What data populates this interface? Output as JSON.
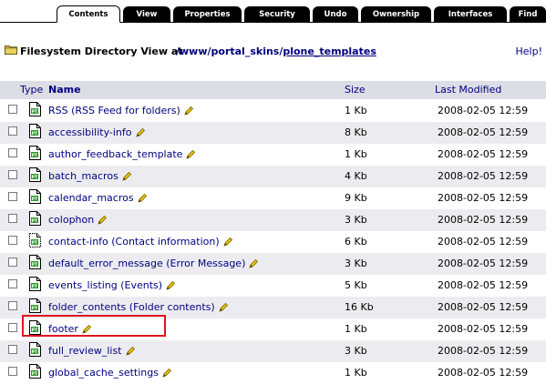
{
  "tabs": [
    {
      "label": "Contents",
      "active": true
    },
    {
      "label": "View",
      "active": false
    },
    {
      "label": "Properties",
      "active": false
    },
    {
      "label": "Security",
      "active": false
    },
    {
      "label": "Undo",
      "active": false
    },
    {
      "label": "Ownership",
      "active": false
    },
    {
      "label": "Interfaces",
      "active": false
    },
    {
      "label": "Find",
      "active": false
    }
  ],
  "header": {
    "label": "Filesystem Directory View at",
    "path_prefix": "/www/portal_skins/",
    "path_current": "plone_templates",
    "help": "Help!"
  },
  "columns": {
    "type": "Type",
    "name": "Name",
    "size": "Size",
    "modified": "Last Modified"
  },
  "rows": [
    {
      "name": "RSS (RSS Feed for folders)",
      "size": "1 Kb",
      "modified": "2008-02-05 12:59",
      "icon": "page-template-icon"
    },
    {
      "name": "accessibility-info",
      "size": "8 Kb",
      "modified": "2008-02-05 12:59",
      "icon": "page-template-icon"
    },
    {
      "name": "author_feedback_template",
      "size": "1 Kb",
      "modified": "2008-02-05 12:59",
      "icon": "page-template-icon"
    },
    {
      "name": "batch_macros",
      "size": "4 Kb",
      "modified": "2008-02-05 12:59",
      "icon": "page-template-icon"
    },
    {
      "name": "calendar_macros",
      "size": "9 Kb",
      "modified": "2008-02-05 12:59",
      "icon": "page-template-icon"
    },
    {
      "name": "colophon",
      "size": "3 Kb",
      "modified": "2008-02-05 12:59",
      "icon": "page-template-icon"
    },
    {
      "name": "contact-info (Contact information)",
      "size": "6 Kb",
      "modified": "2008-02-05 12:59",
      "icon": "form-template-icon"
    },
    {
      "name": "default_error_message (Error Message)",
      "size": "3 Kb",
      "modified": "2008-02-05 12:59",
      "icon": "page-template-icon"
    },
    {
      "name": "events_listing (Events)",
      "size": "5 Kb",
      "modified": "2008-02-05 12:59",
      "icon": "page-template-icon"
    },
    {
      "name": "folder_contents (Folder contents)",
      "size": "16 Kb",
      "modified": "2008-02-05 12:59",
      "icon": "page-template-icon"
    },
    {
      "name": "footer",
      "size": "1 Kb",
      "modified": "2008-02-05 12:59",
      "icon": "page-template-icon",
      "highlighted": true
    },
    {
      "name": "full_review_list",
      "size": "3 Kb",
      "modified": "2008-02-05 12:59",
      "icon": "page-template-icon"
    },
    {
      "name": "global_cache_settings",
      "size": "1 Kb",
      "modified": "2008-02-05 12:59",
      "icon": "page-template-icon"
    }
  ],
  "colors": {
    "link": "#000080",
    "header_bg": "#dddde5",
    "alt_row_bg": "#ececf0",
    "highlight": "#e0141e",
    "pencil": "#e8c400"
  }
}
